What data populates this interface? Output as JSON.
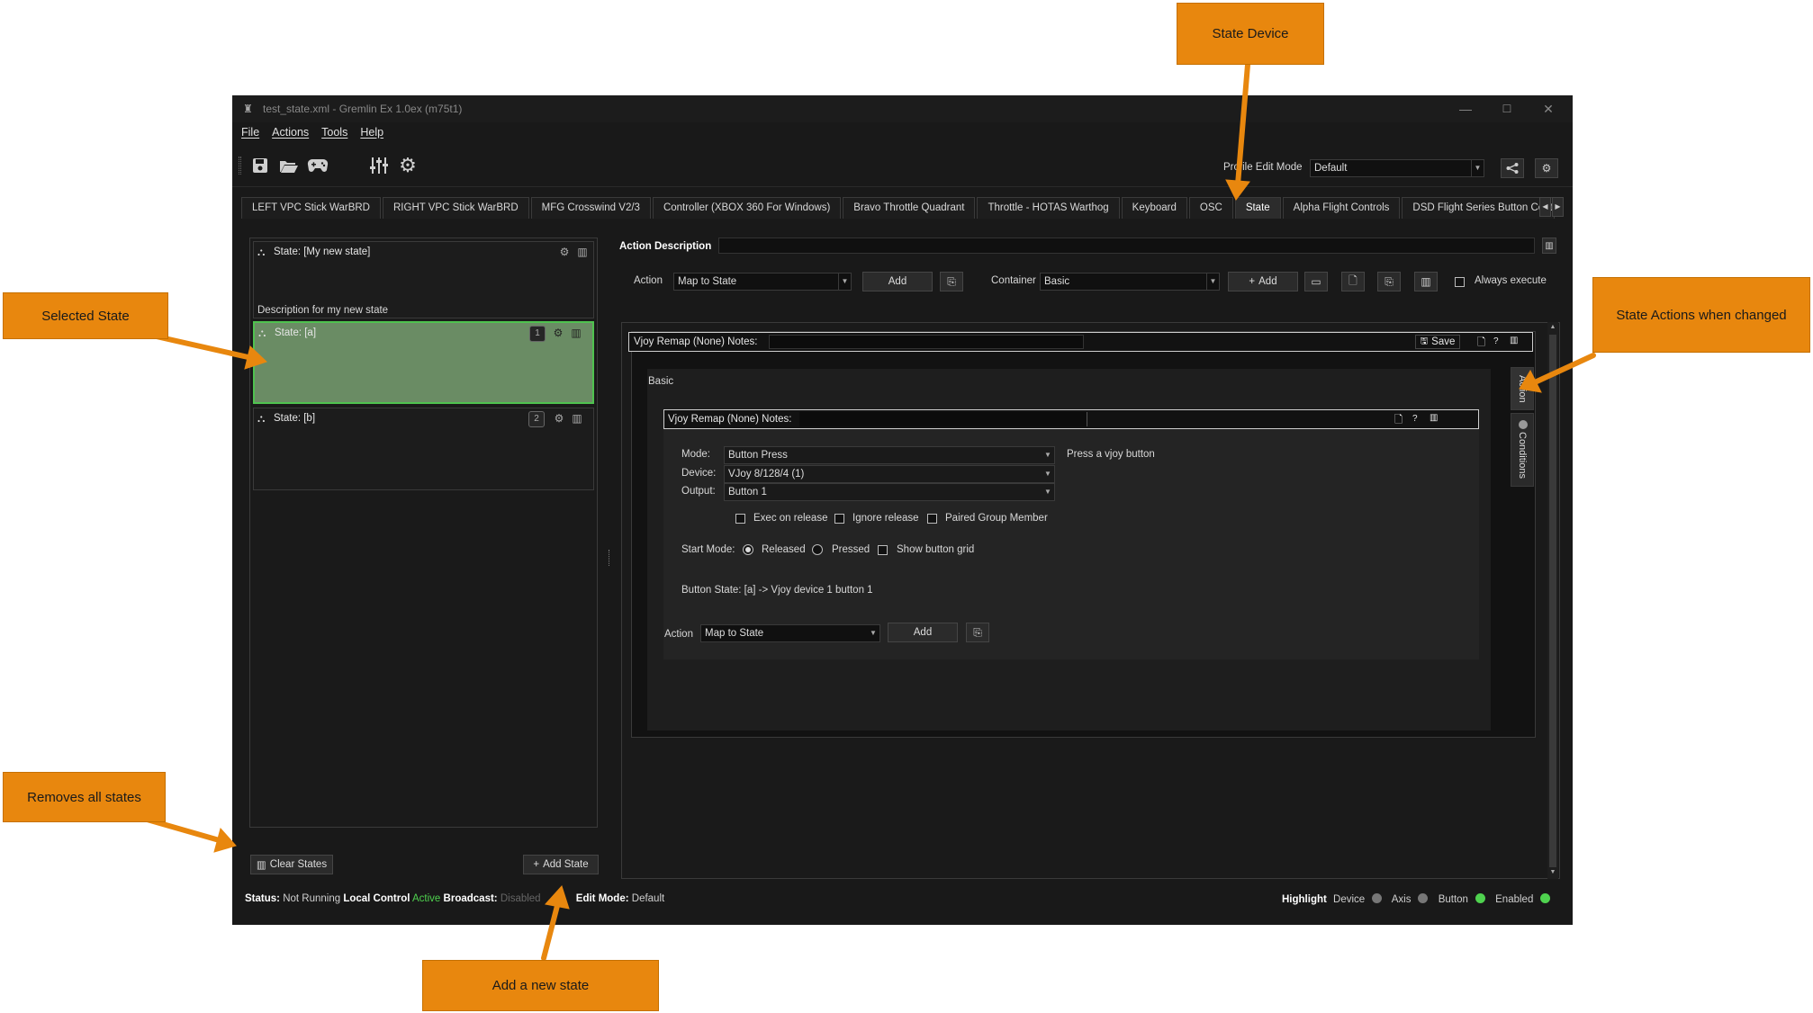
{
  "window": {
    "title": "test_state.xml - Gremlin Ex 1.0ex (m75t1)",
    "minimize": "—",
    "maximize": "☐",
    "close": "✕"
  },
  "menu": [
    "File",
    "Actions",
    "Tools",
    "Help"
  ],
  "toolbar": {
    "edit_mode_label": "Profile Edit Mode",
    "edit_mode_value": "Default"
  },
  "tabs": [
    "LEFT VPC Stick WarBRD",
    "RIGHT VPC Stick WarBRD",
    "MFG Crosswind V2/3",
    "Controller (XBOX 360 For Windows)",
    "Bravo Throttle Quadrant",
    "Throttle - HOTAS Warthog",
    "Keyboard",
    "OSC",
    "State",
    "Alpha Flight Controls",
    "DSD Flight Series Button Cont"
  ],
  "states": {
    "header": "State: [My new state]",
    "header_desc": "Description for my new state",
    "items": [
      {
        "label": "State: [a]",
        "num": "1"
      },
      {
        "label": "State: [b]",
        "num": "2"
      }
    ],
    "clear_label": "Clear States",
    "add_label": "Add State"
  },
  "action_panel": {
    "description_label": "Action Description",
    "action_label": "Action",
    "action_value": "Map to State",
    "add_label": "Add",
    "container_label": "Container",
    "container_value": "Basic",
    "container_add": "Add",
    "always_execute": "Always execute"
  },
  "vjoy_outer": {
    "title": "Vjoy Remap (None)  Notes:",
    "save": "Save",
    "help": "?",
    "basic_label": "Basic"
  },
  "vjoy_inner": {
    "title": "Vjoy Remap (None)  Notes:",
    "help": "?",
    "mode_label": "Mode:",
    "mode_value": "Button Press",
    "mode_hint": "Press a vjoy button",
    "device_label": "Device:",
    "device_value": "VJoy 8/128/4 (1)",
    "output_label": "Output:",
    "output_value": "Button 1",
    "exec_on_release": "Exec on release",
    "ignore_release": "Ignore release",
    "paired_group": "Paired Group Member",
    "start_mode_label": "Start Mode:",
    "released": "Released",
    "pressed": "Pressed",
    "show_grid": "Show button grid",
    "button_state": "Button State: [a] -> Vjoy device 1 button 1"
  },
  "bottom_action": {
    "label": "Action",
    "value": "Map to State",
    "add": "Add"
  },
  "side_tabs": {
    "action": "Action",
    "conditions": "Conditions"
  },
  "status": {
    "status_label": "Status:",
    "status_value": "Not Running",
    "local_label": "Local Control",
    "local_value": "Active",
    "broadcast_label": "Broadcast:",
    "broadcast_value": "Disabled",
    "edit_label": "Edit Mode:",
    "edit_value": "Default",
    "highlight_label": "Highlight",
    "device": "Device",
    "axis": "Axis",
    "button": "Button",
    "enabled": "Enabled"
  },
  "colors": {
    "accent_green": "#4fd24f",
    "selected_state": "#6a8c64",
    "callout": "#e8870e"
  },
  "annotations": {
    "state_device": "State Device",
    "selected_state": "Selected State",
    "state_actions": "State Actions when changed",
    "removes_all": "Removes all states",
    "add_new": "Add a new state"
  }
}
